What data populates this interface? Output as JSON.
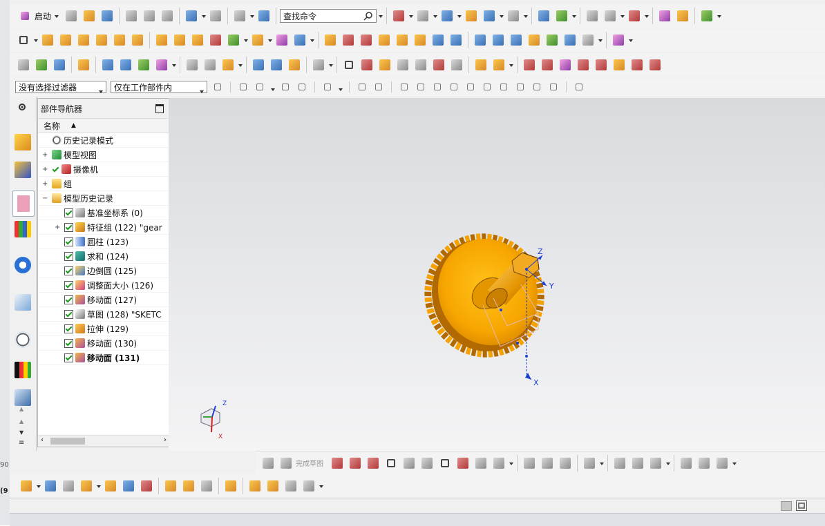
{
  "left_strip": {
    "text_a": "90",
    "text_b": "(9"
  },
  "toolbar": {
    "start_label": "启动",
    "command_search_placeholder": "查找命令"
  },
  "filterbar": {
    "type_filter": "没有选择过滤器",
    "scope_filter": "仅在工作部件内"
  },
  "navigator": {
    "title": "部件导航器",
    "column_name": "名称",
    "items": [
      {
        "label": "历史记录模式",
        "icon": "clock-icon",
        "level": 0,
        "checked": false,
        "expander": ""
      },
      {
        "label": "模型视图",
        "icon": "model-view-icon",
        "level": 0,
        "checked": false,
        "expander": "+"
      },
      {
        "label": "摄像机",
        "icon": "camera-icon",
        "level": 0,
        "checked": true,
        "expander": "+"
      },
      {
        "label": "组",
        "icon": "folder-icon",
        "level": 0,
        "checked": false,
        "expander": "+"
      },
      {
        "label": "模型历史记录",
        "icon": "folder-open-icon",
        "level": 0,
        "checked": false,
        "expander": "-"
      },
      {
        "label": "基准坐标系 (0)",
        "icon": "datum-csys-icon",
        "level": 1,
        "checked": true,
        "expander": ""
      },
      {
        "label": "特征组 (122) \"gear",
        "icon": "feature-group-icon",
        "level": 1,
        "checked": true,
        "expander": "+"
      },
      {
        "label": "圆柱 (123)",
        "icon": "cylinder-icon",
        "level": 1,
        "checked": true,
        "expander": ""
      },
      {
        "label": "求和 (124)",
        "icon": "unite-icon",
        "level": 1,
        "checked": true,
        "expander": ""
      },
      {
        "label": "边倒圆 (125)",
        "icon": "edge-blend-icon",
        "level": 1,
        "checked": true,
        "expander": ""
      },
      {
        "label": "调整面大小 (126)",
        "icon": "resize-face-icon",
        "level": 1,
        "checked": true,
        "expander": ""
      },
      {
        "label": "移动面 (127)",
        "icon": "move-face-icon",
        "level": 1,
        "checked": true,
        "expander": ""
      },
      {
        "label": "草图 (128) \"SKETC",
        "icon": "sketch-icon",
        "level": 1,
        "checked": true,
        "expander": ""
      },
      {
        "label": "拉伸 (129)",
        "icon": "extrude-icon",
        "level": 1,
        "checked": true,
        "expander": ""
      },
      {
        "label": "移动面 (130)",
        "icon": "move-face-icon",
        "level": 1,
        "checked": true,
        "expander": ""
      },
      {
        "label": "移动面 (131)",
        "icon": "move-face-icon",
        "level": 1,
        "checked": true,
        "expander": "",
        "bold": true
      }
    ]
  },
  "viewport": {
    "axis_z": "Z",
    "axis_y": "Y",
    "axis_x": "X",
    "triad_z": "Z",
    "triad_x": "X"
  },
  "sketchbar": {
    "finish_sketch_label": "完成草图"
  },
  "colors": {
    "gear": "#f5a100",
    "gear_dark": "#b26a00",
    "axis_blue": "#1b3fd1",
    "axis_red": "#d12020"
  }
}
